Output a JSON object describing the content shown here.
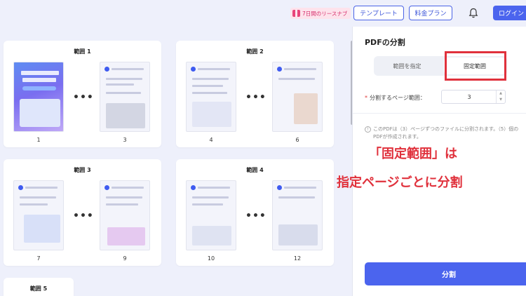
{
  "topbar": {
    "promo_label": "7日間のリースナブ",
    "template_label": "テンプレート",
    "plan_label": "料金プラン",
    "login_label": "ログイン"
  },
  "ranges": [
    {
      "title": "範囲 1",
      "first_page": "1",
      "last_page": "3"
    },
    {
      "title": "範囲 2",
      "first_page": "4",
      "last_page": "6"
    },
    {
      "title": "範囲 3",
      "first_page": "7",
      "last_page": "9"
    },
    {
      "title": "範囲 4",
      "first_page": "10",
      "last_page": "12"
    },
    {
      "title": "範囲 5"
    }
  ],
  "ellipsis": "•••",
  "panel": {
    "title": "PDFの分割",
    "tab_range": "範囲を指定",
    "tab_fixed": "固定範囲",
    "field_label": "分割するページ範囲：",
    "field_required": "*",
    "field_value": "3",
    "stepper_up": "▲",
    "stepper_down": "▼",
    "info_icon": "!",
    "info_text": "このPDFは（3）ページずつのファイルに分割されます。（5）個のPDFが作成されます。",
    "split_label": "分割"
  },
  "annotation": {
    "line1": "「固定範囲」は",
    "line2": "指定ページごとに分割"
  },
  "colors": {
    "accent": "#4b64ee",
    "highlight": "#e0313c",
    "background": "#eef0fb"
  }
}
